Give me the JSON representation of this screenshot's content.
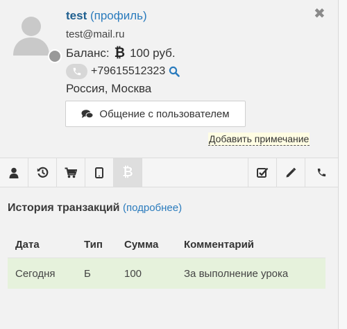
{
  "profile": {
    "name": "test",
    "profile_link": "(профиль)",
    "email": "test@mail.ru",
    "balance_label": "Баланс:",
    "balance_value": "100 руб.",
    "phone": "+79615512323",
    "location": "Россия, Москва"
  },
  "actions": {
    "chat_button": "Общение с пользователем",
    "add_note": "Добавить примечание"
  },
  "toolbar": {
    "left_icons": [
      "user-icon",
      "history-icon",
      "cart-icon",
      "tablet-icon",
      "bitcoin-icon"
    ],
    "right_icons": [
      "checkbox-icon",
      "pencil-icon",
      "phone-icon"
    ],
    "active": "bitcoin-icon"
  },
  "transactions": {
    "title": "История транзакций",
    "more_link": "(подробнее)",
    "columns": [
      "Дата",
      "Тип",
      "Сумма",
      "Комментарий"
    ],
    "rows": [
      {
        "date": "Сегодня",
        "type": "Б",
        "amount": "100",
        "comment": "За выполнение урока"
      }
    ]
  },
  "colors": {
    "link": "#2a7bbd",
    "name": "#1f5f8f",
    "row_highlight": "#e6f2dc",
    "note_bg": "#fffde3"
  }
}
